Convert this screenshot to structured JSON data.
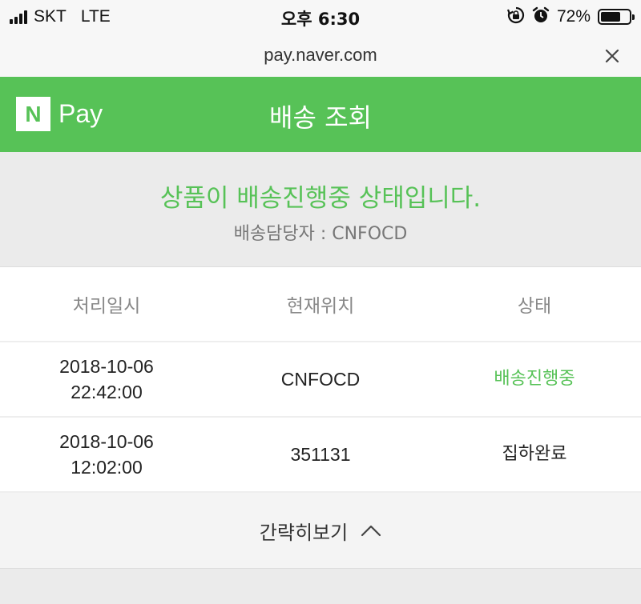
{
  "status_bar": {
    "carrier": "SKT",
    "network": "LTE",
    "time": "오후 6:30",
    "battery_percent": "72%",
    "battery_level": 0.72,
    "icons": [
      "signal-icon",
      "rotation-lock-icon",
      "alarm-icon",
      "battery-icon"
    ]
  },
  "browser": {
    "url": "pay.naver.com",
    "close_icon": "close-icon"
  },
  "header": {
    "logo_letter": "N",
    "logo_text": "Pay",
    "title": "배송 조회",
    "brand_color": "#57c257"
  },
  "summary": {
    "message": "상품이 배송진행중 상태입니다.",
    "carrier_line": "배송담당자 : CNFOCD"
  },
  "table": {
    "headers": [
      "처리일시",
      "현재위치",
      "상태"
    ],
    "rows": [
      {
        "date": "2018-10-06",
        "time": "22:42:00",
        "location": "CNFOCD",
        "status": "배송진행중"
      },
      {
        "date": "2018-10-06",
        "time": "12:02:00",
        "location": "351131",
        "status": "집하완료"
      }
    ]
  },
  "collapse": {
    "label": "간략히보기",
    "icon": "chevron-up-icon"
  }
}
